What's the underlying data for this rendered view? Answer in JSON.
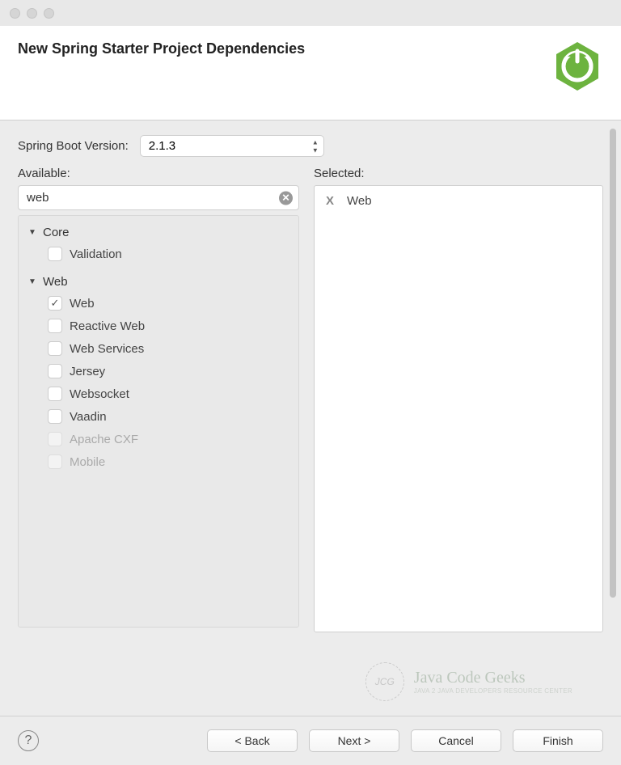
{
  "window": {
    "title": "New Spring Starter Project Dependencies"
  },
  "form": {
    "version_label": "Spring Boot Version:",
    "version_value": "2.1.3",
    "available_label": "Available:",
    "selected_label": "Selected:",
    "search_value": "web"
  },
  "tree": {
    "groups": [
      {
        "name": "Core",
        "items": [
          {
            "label": "Validation",
            "checked": false,
            "disabled": false
          }
        ]
      },
      {
        "name": "Web",
        "items": [
          {
            "label": "Web",
            "checked": true,
            "disabled": false
          },
          {
            "label": "Reactive Web",
            "checked": false,
            "disabled": false
          },
          {
            "label": "Web Services",
            "checked": false,
            "disabled": false
          },
          {
            "label": "Jersey",
            "checked": false,
            "disabled": false
          },
          {
            "label": "Websocket",
            "checked": false,
            "disabled": false
          },
          {
            "label": "Vaadin",
            "checked": false,
            "disabled": false
          },
          {
            "label": "Apache CXF",
            "checked": false,
            "disabled": true
          },
          {
            "label": "Mobile",
            "checked": false,
            "disabled": true
          }
        ]
      }
    ]
  },
  "selected": [
    {
      "label": "Web"
    }
  ],
  "footer": {
    "back": "< Back",
    "next": "Next >",
    "cancel": "Cancel",
    "finish": "Finish"
  },
  "watermark": {
    "main": "Java Code Geeks",
    "sub": "JAVA 2 JAVA DEVELOPERS RESOURCE CENTER",
    "badge": "JCG"
  }
}
